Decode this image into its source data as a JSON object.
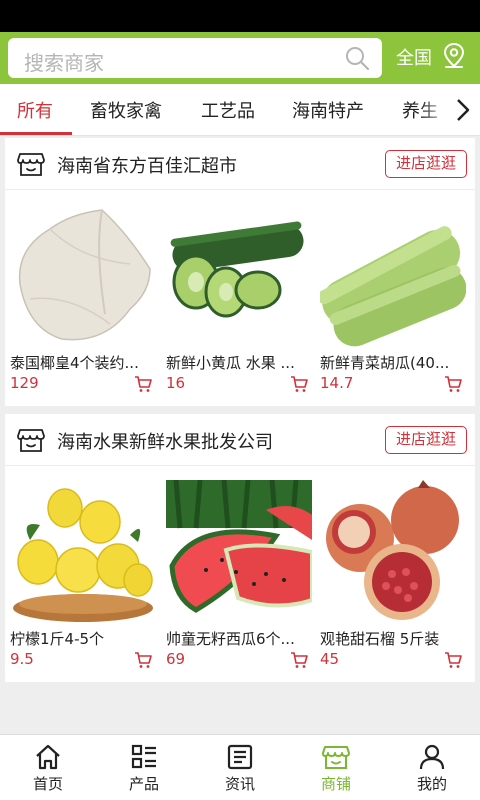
{
  "header": {
    "search_placeholder": "搜索商家",
    "region": "全国"
  },
  "tabs": [
    "所有",
    "畜牧家禽",
    "工艺品",
    "海南特产",
    "养生"
  ],
  "stores": [
    {
      "name": "海南省东方百佳汇超市",
      "button": "进店逛逛",
      "products": [
        {
          "name": "泰国椰皇4个装约...",
          "price": "129"
        },
        {
          "name": "新鲜小黄瓜 水果 ...",
          "price": "16"
        },
        {
          "name": "新鲜青菜胡瓜(40...",
          "price": "14.7"
        }
      ]
    },
    {
      "name": "海南水果新鲜水果批发公司",
      "button": "进店逛逛",
      "products": [
        {
          "name": "柠檬1斤4-5个",
          "price": "9.5"
        },
        {
          "name": "帅童无籽西瓜6个...",
          "price": "69"
        },
        {
          "name": "观艳甜石榴 5斤装",
          "price": "45"
        }
      ]
    }
  ],
  "bottom_nav": [
    {
      "label": "首页",
      "icon": "home-icon"
    },
    {
      "label": "产品",
      "icon": "list-icon"
    },
    {
      "label": "资讯",
      "icon": "news-icon"
    },
    {
      "label": "商铺",
      "icon": "store-icon",
      "active": true
    },
    {
      "label": "我的",
      "icon": "user-icon"
    }
  ],
  "colors": {
    "brand_green": "#8cc43c",
    "accent_red": "#d3303a",
    "active_nav": "#7cb82f"
  }
}
